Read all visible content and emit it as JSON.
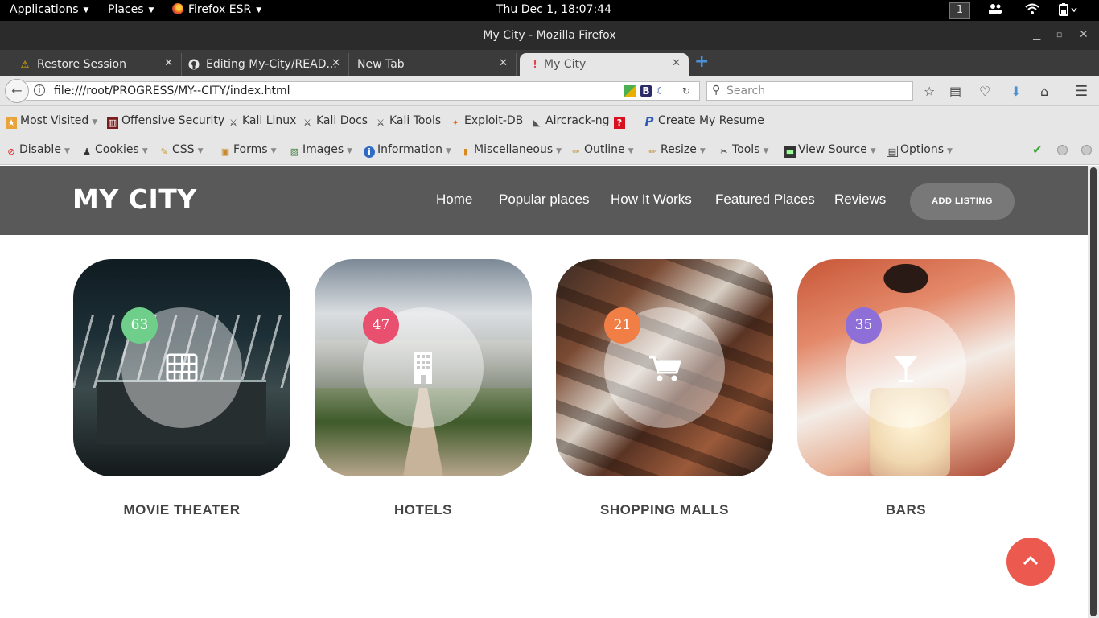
{
  "system": {
    "applications": "Applications",
    "places": "Places",
    "browser_app": "Firefox ESR",
    "clock": "Thu Dec  1, 18:07:44",
    "workspace": "1"
  },
  "window": {
    "title": "My City - Mozilla Firefox"
  },
  "tabs": [
    {
      "label": "Restore Session",
      "icon": "warning-icon"
    },
    {
      "label": "Editing My-City/READ...",
      "icon": "github-icon"
    },
    {
      "label": "New Tab",
      "icon": ""
    },
    {
      "label": "My City",
      "icon": "page-icon",
      "active": true
    }
  ],
  "navbar": {
    "url": "file:///root/PROGRESS/MY--CITY/index.html",
    "search_placeholder": "Search"
  },
  "bookmarks": [
    {
      "label": "Most Visited",
      "icon": "folder-icon",
      "dropdown": true
    },
    {
      "label": "Offensive Security",
      "icon": "offsec-icon"
    },
    {
      "label": "Kali Linux",
      "icon": "kali-icon"
    },
    {
      "label": "Kali Docs",
      "icon": "kali-icon"
    },
    {
      "label": "Kali Tools",
      "icon": "kali-icon"
    },
    {
      "label": "Exploit-DB",
      "icon": "exploitdb-icon"
    },
    {
      "label": "Aircrack-ng",
      "icon": "aircrack-icon"
    },
    {
      "label": "",
      "icon": "help-icon"
    },
    {
      "label": "Create My Resume",
      "icon": "resume-icon"
    }
  ],
  "devtools": [
    {
      "label": "Disable",
      "icon": "disable-icon"
    },
    {
      "label": "Cookies",
      "icon": "cookies-icon"
    },
    {
      "label": "CSS",
      "icon": "css-icon"
    },
    {
      "label": "Forms",
      "icon": "forms-icon"
    },
    {
      "label": "Images",
      "icon": "images-icon"
    },
    {
      "label": "Information",
      "icon": "info-icon"
    },
    {
      "label": "Miscellaneous",
      "icon": "misc-icon"
    },
    {
      "label": "Outline",
      "icon": "outline-icon"
    },
    {
      "label": "Resize",
      "icon": "resize-icon"
    },
    {
      "label": "Tools",
      "icon": "tools-icon"
    },
    {
      "label": "View Source",
      "icon": "view-source-icon"
    },
    {
      "label": "Options",
      "icon": "options-icon"
    }
  ],
  "site": {
    "logo": "MY CITY",
    "menu": [
      "Home",
      "Popular places",
      "How It Works",
      "Featured Places",
      "Reviews"
    ],
    "cta": "ADD LISTING",
    "categories": [
      {
        "title": "MOVIE THEATER",
        "count": "63",
        "badge_color": "#6fcf8a",
        "icon": "film-icon"
      },
      {
        "title": "HOTELS",
        "count": "47",
        "badge_color": "#e9506f",
        "icon": "building-icon"
      },
      {
        "title": "SHOPPING MALLS",
        "count": "21",
        "badge_color": "#f07e45",
        "icon": "cart-icon"
      },
      {
        "title": "BARS",
        "count": "35",
        "badge_color": "#8e6fd8",
        "icon": "cocktail-icon"
      }
    ],
    "back_to_top_color": "#ec5a4f"
  }
}
